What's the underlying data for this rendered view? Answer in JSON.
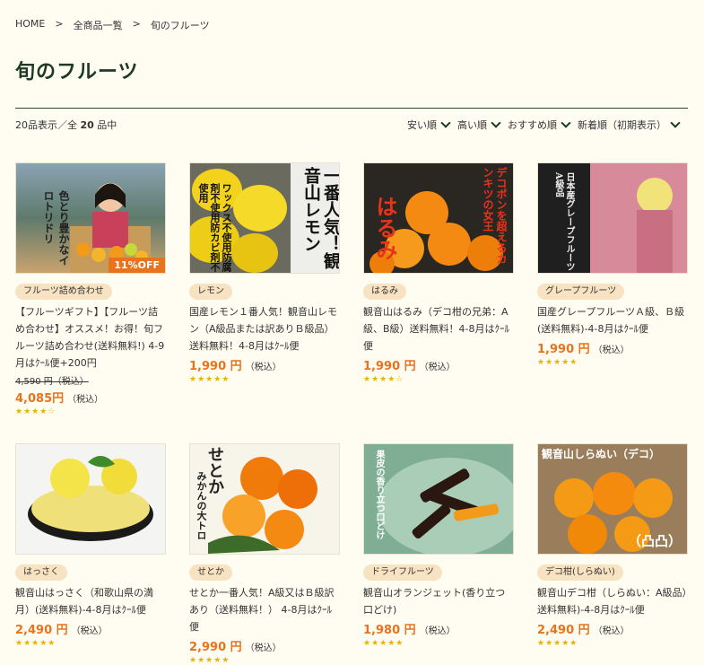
{
  "breadcrumb": [
    "HOME",
    "全商品一覧",
    "旬のフルーツ"
  ],
  "breadcrumb_sep": ">",
  "page_title": "旬のフルーツ",
  "count": {
    "prefix": "20品表示／全 ",
    "total": "20",
    "suffix": " 品中"
  },
  "sorts": [
    "安い順",
    "高い順",
    "おすすめ順",
    "新着順（初期表示）"
  ],
  "products": [
    {
      "tag": "フルーツ詰め合わせ",
      "name": "【フルーツギフト】【フルーツ詰め合わせ】オススメ！お得！旬フルーツ詰め合わせ(送料無料!) 4-9月はｸｰﾙ便+200円",
      "old_price": "4,590 円（税込）",
      "price": "4,085円",
      "tax": "（税込）",
      "rating": "★★★★☆",
      "image_text": "色とり豊かなイロトリドリ",
      "badge": "11%OFF"
    },
    {
      "tag": "レモン",
      "name": "国産レモン１番人気！観音山レモン（A級品または訳ありＢ級品）送料無料！4-8月はｸｰﾙ便",
      "price": "1,990 円",
      "tax": "（税込）",
      "rating": "★★★★★",
      "image_text": "一番人気！観音山レモン",
      "image_text2": "ワックス不使用防腐剤不使用防カビ剤不使用"
    },
    {
      "tag": "はるみ",
      "name": "観音山はるみ（デコ柑の兄弟：A級、B級）送料無料！4-8月はｸｰﾙ便",
      "price": "1,990 円",
      "tax": "（税込）",
      "rating": "★★★★☆",
      "image_text": "はるみ",
      "image_text2": "デコポンを超えるカンキツの女王"
    },
    {
      "tag": "グレープフルーツ",
      "name": "国産グレープフルーツＡ級、Ｂ級(送料無料)-4-8月はｸｰﾙ便",
      "price": "1,990 円",
      "tax": "（税込）",
      "rating": "★★★★★",
      "image_text": "日本産グレープフルーツA級品"
    },
    {
      "tag": "はっさく",
      "name": "観音山はっさく（和歌山県の満月）(送料無料)-4-8月はｸｰﾙ便",
      "price": "2,490 円",
      "tax": "（税込）",
      "rating": "★★★★★"
    },
    {
      "tag": "せとか",
      "name": "せとか一番人気！A級又はＢ級訳あり（送料無料！） 4-8月はｸｰﾙ便",
      "price": "2,990 円",
      "tax": "（税込）",
      "rating": "★★★★★",
      "image_text": "せとか",
      "image_text2": "みかんの大トロ"
    },
    {
      "tag": "ドライフルーツ",
      "name": "観音山オランジェット(香り立つ口どけ)",
      "price": "1,980 円",
      "tax": "（税込）",
      "rating": "★★★★★",
      "image_text": "果皮の香り立つ口どけ"
    },
    {
      "tag": "デコ柑(しらぬい)",
      "name": "観音山デコ柑（しらぬい：A級品）送料無料)-4-8月はｸｰﾙ便",
      "price": "2,490 円",
      "tax": "（税込）",
      "rating": "★★★★★",
      "image_text": "観音山しらぬい（デコ）",
      "image_text2": "（凸凸）"
    }
  ]
}
